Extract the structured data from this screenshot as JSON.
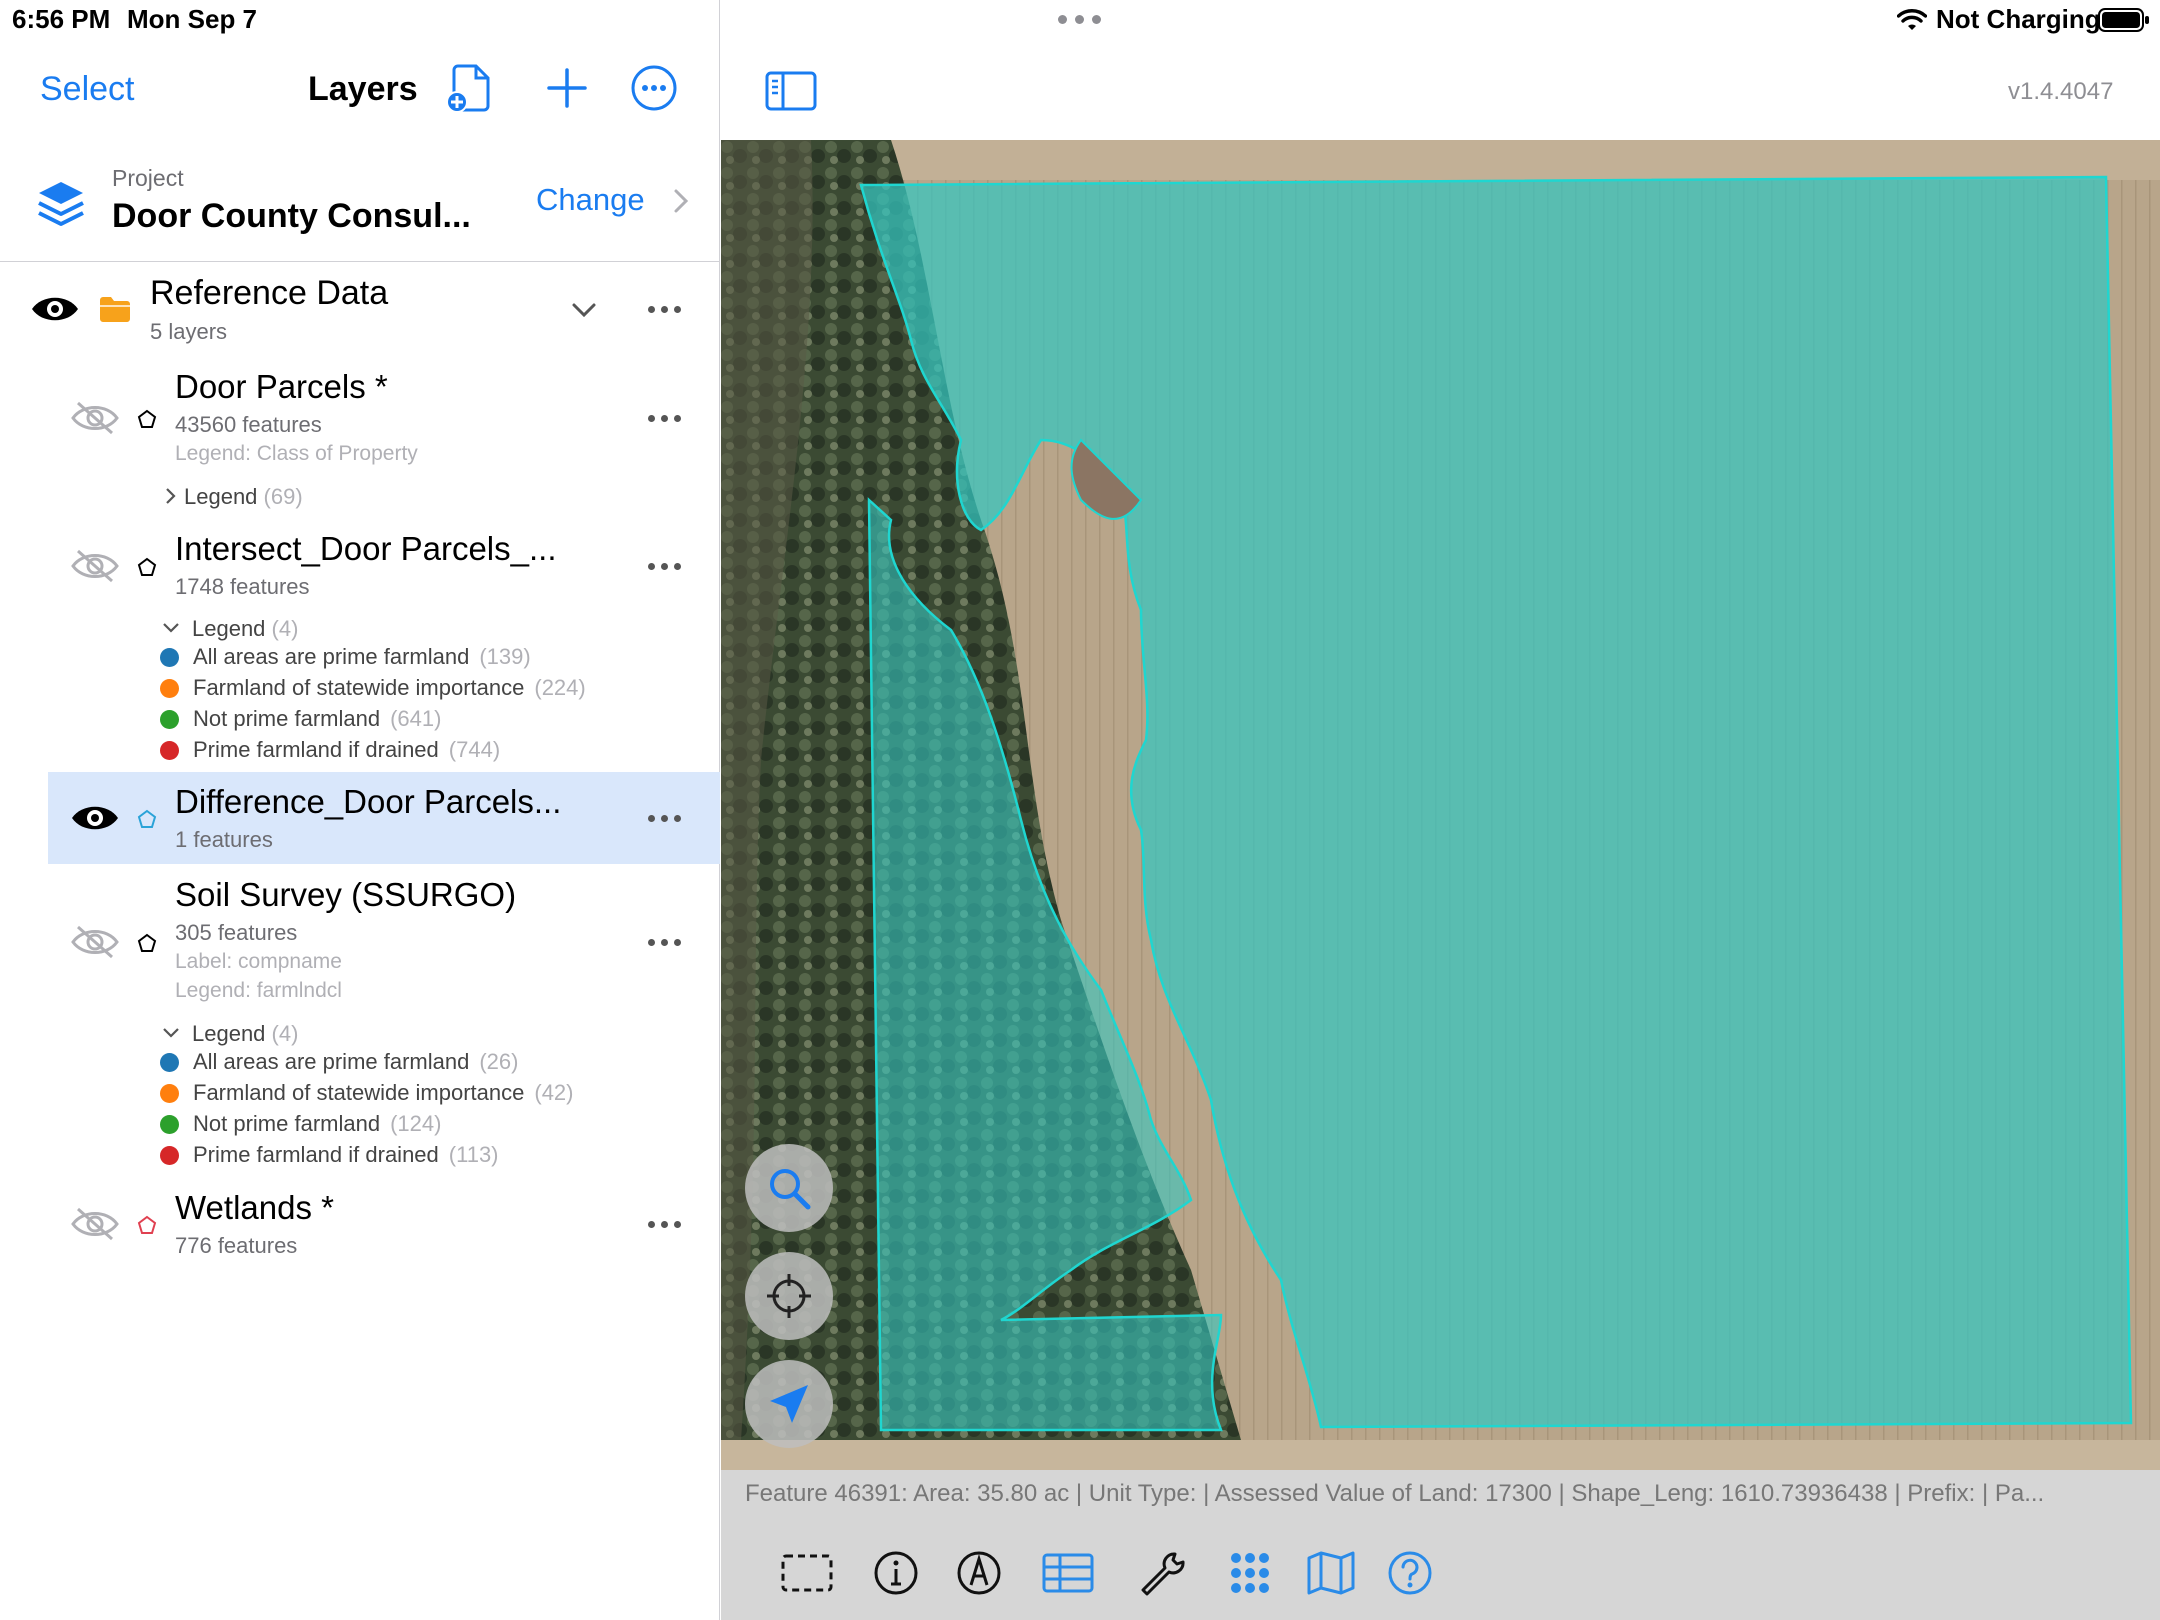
{
  "status": {
    "time": "6:56 PM",
    "date": "Mon Sep 7",
    "battery_text": "Not Charging"
  },
  "nav": {
    "select_label": "Select",
    "title": "Layers",
    "icons": [
      "new-document-icon",
      "plus-icon",
      "more-circle-icon"
    ]
  },
  "project": {
    "label": "Project",
    "name": "Door County Consul...",
    "change_label": "Change"
  },
  "group": {
    "title": "Reference Data",
    "subtitle": "5 layers"
  },
  "layers": [
    {
      "title": "Door Parcels *",
      "features": "43560 features",
      "meta": [
        "Legend: Class of Property"
      ],
      "legend_label": "Legend",
      "legend_count": "(69)",
      "visible": false,
      "poly_color": "#000000"
    },
    {
      "title": "Intersect_Door Parcels_...",
      "features": "1748 features",
      "legend_label": "Legend",
      "legend_count": "(4)",
      "legend": [
        {
          "label": "All areas are prime farmland",
          "count": "(139)",
          "color": "#1f77b4"
        },
        {
          "label": "Farmland of statewide importance",
          "count": "(224)",
          "color": "#ff7f0e"
        },
        {
          "label": "Not prime farmland",
          "count": "(641)",
          "color": "#2ca02c"
        },
        {
          "label": "Prime farmland if drained",
          "count": "(744)",
          "color": "#d62728"
        }
      ],
      "visible": false,
      "poly_color": "#000000"
    },
    {
      "title": "Difference_Door Parcels...",
      "features": "1 features",
      "visible": true,
      "selected": true,
      "poly_color": "#2aa3d8"
    },
    {
      "title": "Soil Survey (SSURGO)",
      "features": "305 features",
      "meta": [
        "Label: compname",
        "Legend: farmlndcl"
      ],
      "legend_label": "Legend",
      "legend_count": "(4)",
      "legend": [
        {
          "label": "All areas are prime farmland",
          "count": "(26)",
          "color": "#1f77b4"
        },
        {
          "label": "Farmland of statewide importance",
          "count": "(42)",
          "color": "#ff7f0e"
        },
        {
          "label": "Not prime farmland",
          "count": "(124)",
          "color": "#2ca02c"
        },
        {
          "label": "Prime farmland if drained",
          "count": "(113)",
          "color": "#d62728"
        }
      ],
      "visible": false,
      "poly_color": "#000000"
    },
    {
      "title": "Wetlands *",
      "features": "776 features",
      "visible": false,
      "poly_color": "#e04050"
    }
  ],
  "map": {
    "version": "v1.4.4047",
    "attribute_text": "Feature 46391: Area: 35.80 ac | Unit Type:  | Assessed Value of Land: 17300 | Shape_Leng: 1610.73936438 | Prefix:  | Pa...",
    "fabs": [
      "search-icon",
      "crosshair-icon",
      "location-arrow-icon"
    ],
    "tools": [
      "select-rectangle-icon",
      "info-icon",
      "pen-icon",
      "table-icon",
      "wrench-icon",
      "grid-icon",
      "map-icon",
      "help-icon"
    ],
    "accent": "#1a7cf0",
    "overlay": "#35c6c0"
  }
}
